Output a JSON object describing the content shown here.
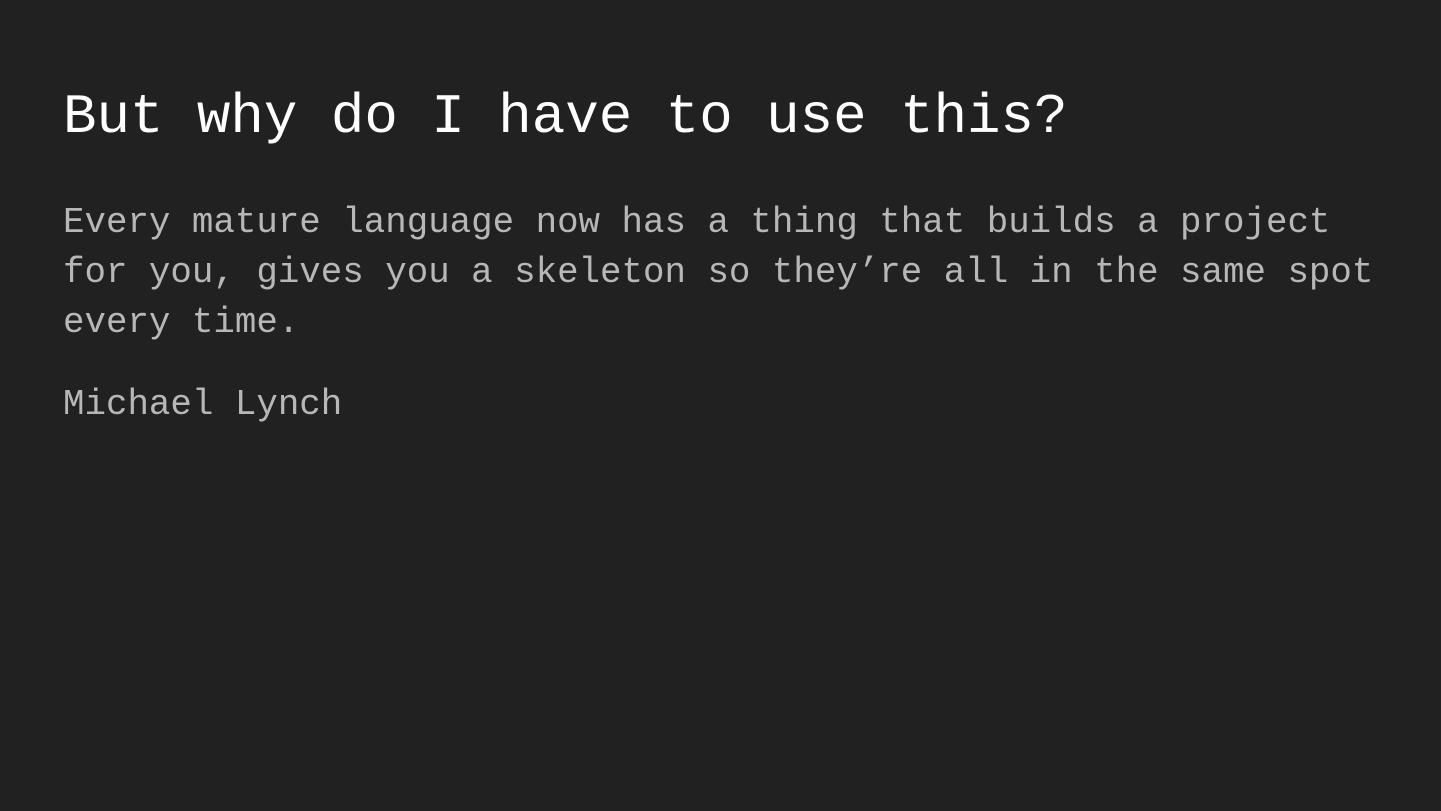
{
  "slide": {
    "title": "But why do I have to use this?",
    "quote": "Every mature language now has a thing that builds a project for you, gives you a skeleton so they’re all in the same spot every time.",
    "author": "Michael Lynch"
  },
  "colors": {
    "background": "#212121",
    "title": "#ffffff",
    "body": "#b7b7b7"
  }
}
